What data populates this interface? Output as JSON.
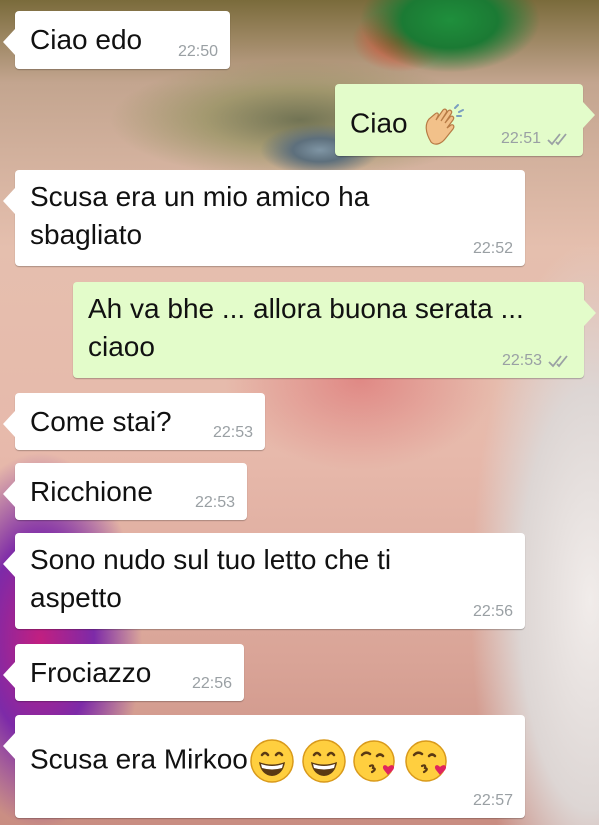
{
  "messages": [
    {
      "text": "Ciao edo",
      "time": "22:50",
      "direction": "incoming"
    },
    {
      "text": "Ciao",
      "emoji": [
        "waving-hand"
      ],
      "time": "22:51",
      "direction": "outgoing",
      "status": "read"
    },
    {
      "text": "Scusa era un mio amico ha sbagliato",
      "time": "22:52",
      "direction": "incoming"
    },
    {
      "text": "Ah va bhe ... allora buona serata ... ciaoo",
      "time": "22:53",
      "direction": "outgoing",
      "status": "read"
    },
    {
      "text": "Come stai?",
      "time": "22:53",
      "direction": "incoming"
    },
    {
      "text": "Ricchione",
      "time": "22:53",
      "direction": "incoming"
    },
    {
      "text": "Sono nudo sul tuo letto che ti aspetto",
      "time": "22:56",
      "direction": "incoming"
    },
    {
      "text": "Frociazzo",
      "time": "22:56",
      "direction": "incoming"
    },
    {
      "text": "Scusa era Mirkoo",
      "emoji": [
        "grinning-face",
        "grinning-face",
        "face-throwing-kiss",
        "face-throwing-kiss"
      ],
      "time": "22:57",
      "direction": "incoming"
    }
  ],
  "colors": {
    "incoming_bubble": "#ffffff",
    "outgoing_bubble": "#e3fcca",
    "timestamp": "#9aa0a4",
    "read_ticks": "#9aa0a4"
  }
}
